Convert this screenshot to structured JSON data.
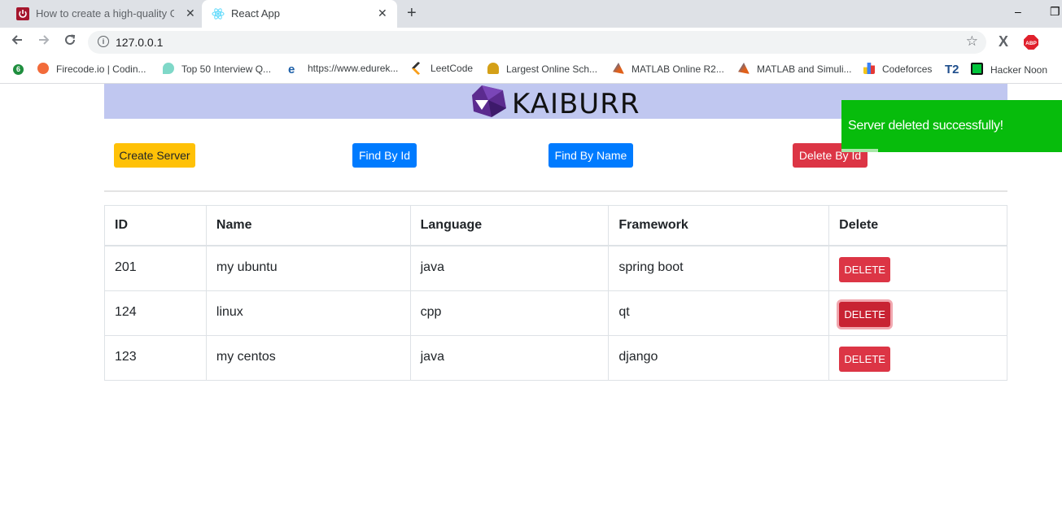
{
  "browser": {
    "tabs": [
      {
        "title": "How to create a high-quality GIF",
        "close": "✕"
      },
      {
        "title": "React App",
        "close": "✕"
      }
    ],
    "new_tab": "+",
    "window_minimize": "–",
    "window_restore": "❐",
    "url": "127.0.0.1",
    "bookmarks": [
      {
        "label": "Firecode.io | Codin...",
        "color": "#f26b3a"
      },
      {
        "label": "Top 50 Interview Q...",
        "color": "#7fd8c8"
      },
      {
        "label": "https://www.edurek...",
        "color": "#1c5fa8"
      },
      {
        "label": "LeetCode",
        "color": "#f89f1b"
      },
      {
        "label": "Largest Online Sch...",
        "color": "#d4a017"
      },
      {
        "label": "MATLAB Online R2...",
        "color": "#e0601a"
      },
      {
        "label": "MATLAB and Simuli...",
        "color": "#e0601a"
      },
      {
        "label": "Codeforces",
        "color": "#3b82f6"
      },
      {
        "label": "Hacker Noon",
        "color": "#00c43a"
      }
    ],
    "apps_badge": "6",
    "t2_icon": "T2",
    "x_extension": "X",
    "abp_extension": "ABP"
  },
  "app": {
    "logo_text": "KAIBURR",
    "buttons": {
      "create": "Create Server",
      "find_id": "Find By Id",
      "find_name": "Find By Name",
      "delete_id": "Delete By Id"
    },
    "table": {
      "headers": [
        "ID",
        "Name",
        "Language",
        "Framework",
        "Delete"
      ],
      "rows": [
        {
          "id": "201",
          "name": "my ubuntu",
          "language": "java",
          "framework": "spring boot",
          "action": "DELETE"
        },
        {
          "id": "124",
          "name": "linux",
          "language": "cpp",
          "framework": "qt",
          "action": "DELETE"
        },
        {
          "id": "123",
          "name": "my centos",
          "language": "java",
          "framework": "django",
          "action": "DELETE"
        }
      ]
    },
    "toast": {
      "message": "Server deleted successfully!",
      "color": "#07bc0c"
    }
  }
}
